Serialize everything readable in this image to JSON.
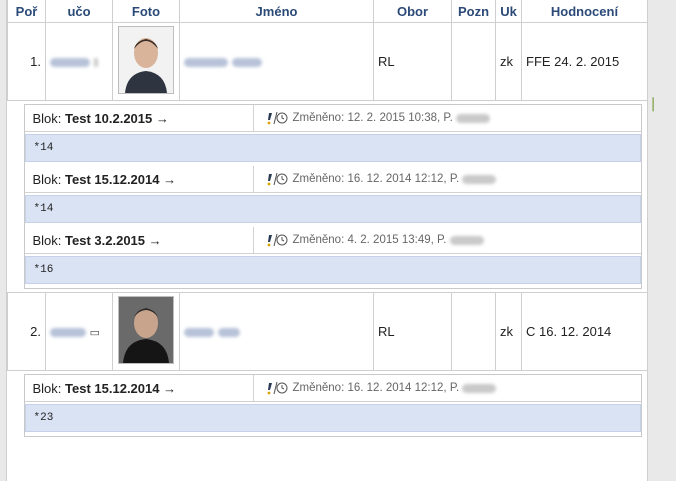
{
  "headers": [
    "Poř",
    "učo",
    "Foto",
    "Jméno",
    "Obor",
    "Pozn",
    "Uk",
    "Hodnocení"
  ],
  "students": [
    {
      "order": "1.",
      "field": "RL",
      "note": "",
      "completion": "zk",
      "grade": "FFE 24. 2. 2015",
      "blocks": [
        {
          "prefix": "Blok:",
          "name": "Test 10.2.2015",
          "arrow": "→",
          "changed_label": "Změněno:",
          "changed_value": "12. 2. 2015 10:38,",
          "initial": "P.",
          "note": "*14"
        },
        {
          "prefix": "Blok:",
          "name": "Test 15.12.2014",
          "arrow": "→",
          "changed_label": "Změněno:",
          "changed_value": "16. 12. 2014 12:12,",
          "initial": "P.",
          "note": "*14"
        },
        {
          "prefix": "Blok:",
          "name": "Test 3.2.2015",
          "arrow": "→",
          "changed_label": "Změněno:",
          "changed_value": "4. 2. 2015 13:49,",
          "initial": "P.",
          "note": "*16"
        }
      ]
    },
    {
      "order": "2.",
      "field": "RL",
      "note": "",
      "completion": "zk",
      "grade": "C 16. 12. 2014",
      "blocks": [
        {
          "prefix": "Blok:",
          "name": "Test 15.12.2014",
          "arrow": "→",
          "changed_label": "Změněno:",
          "changed_value": "16. 12. 2014 12:12,",
          "initial": "P.",
          "note": "*23"
        }
      ]
    }
  ],
  "colors": {
    "header_text": "#2b4a78",
    "note_bg": "#d9e3f3",
    "grid": "#cfcfcf"
  },
  "icons": [
    "edit-history-icon",
    "message-icon"
  ]
}
